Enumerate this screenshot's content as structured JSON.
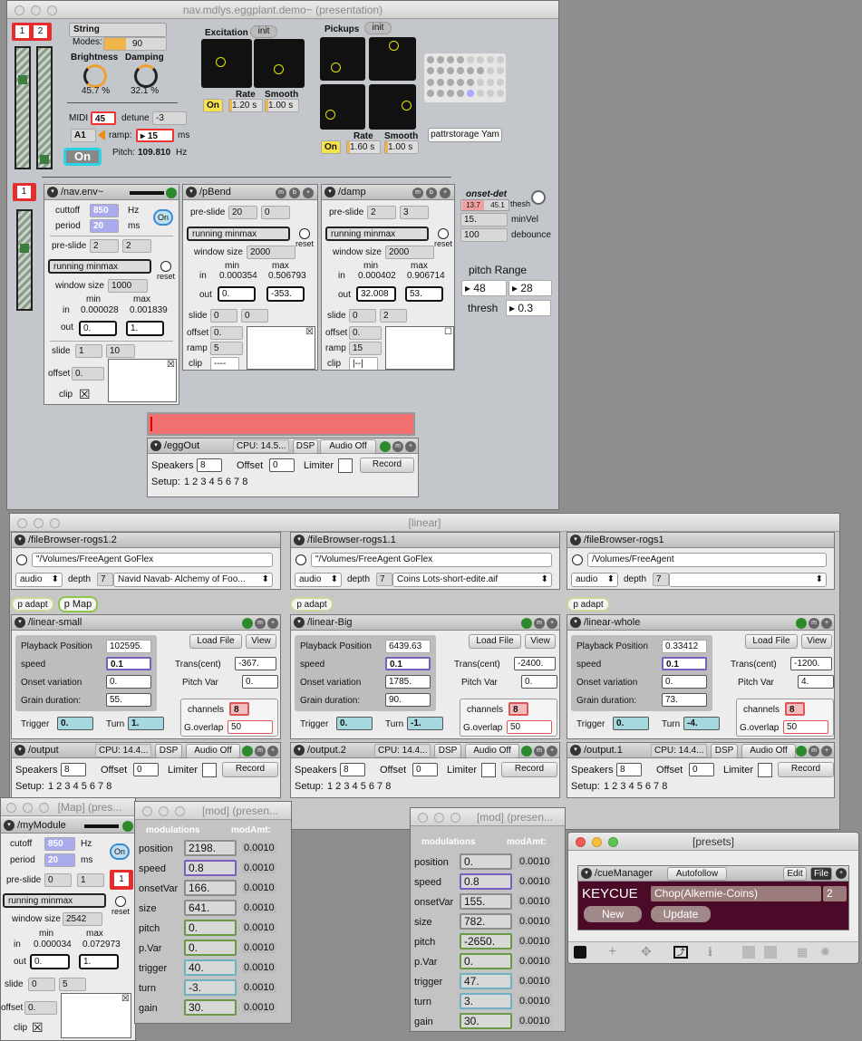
{
  "main_window": {
    "title": "nav.mdlys.eggplant.demo~ (presentation)",
    "badge1": "1",
    "badge2": "2",
    "instrument": "String",
    "modes_label": "Modes:",
    "modes_value": "90",
    "brightness_label": "Brightness",
    "brightness_value": "45.7 %",
    "damping_label": "Damping",
    "damping_value": "32.1 %",
    "midi_label": "MIDI",
    "midi_value": "45",
    "detune_label": "detune",
    "detune_value": "-3",
    "note": "A1",
    "ramp_label": "ramp:",
    "ramp_value": "15",
    "ramp_unit": "ms",
    "on_label": "On",
    "pitch_label": "Pitch:",
    "pitch_value": "109.810",
    "pitch_unit": "Hz",
    "excitation": {
      "label": "Excitation",
      "init": "init",
      "on": "On",
      "rate_label": "Rate",
      "rate_value": "1.20 s",
      "smooth_label": "Smooth",
      "smooth_value": "1.00 s"
    },
    "pickups": {
      "label": "Pickups",
      "init": "init",
      "on": "On",
      "rate_label": "Rate",
      "rate_value": "1.60 s",
      "smooth_label": "Smooth",
      "smooth_value": "1.00 s",
      "pattr": "pattrstorage Yam"
    },
    "env_badge": "1",
    "nav_env": {
      "title": "/nav.env~",
      "cutoff_label": "cuttoff",
      "cutoff_value": "850",
      "cutoff_unit": "Hz",
      "period_label": "period",
      "period_value": "20",
      "period_unit": "ms",
      "on": "On",
      "preslide_label": "pre-slide",
      "preslide_a": "2",
      "preslide_b": "2",
      "mode": "running minmax",
      "reset": "reset",
      "window_label": "window size",
      "window_value": "1000",
      "min_label": "min",
      "max_label": "max",
      "in_label": "in",
      "in_min": "0.000028",
      "in_max": "0.001839",
      "out_label": "out",
      "out_a": "0.",
      "out_b": "1.",
      "slide_label": "slide",
      "slide_a": "1",
      "slide_b": "10",
      "offset_label": "offset",
      "offset_value": "0.",
      "clip_label": "clip"
    },
    "pbend": {
      "title": "/pBend",
      "preslide_label": "pre-slide",
      "preslide_a": "20",
      "preslide_b": "0",
      "mode": "running minmax",
      "reset": "reset",
      "window_label": "window size",
      "window_value": "2000",
      "min_label": "min",
      "max_label": "max",
      "in_label": "in",
      "in_min": "0.000354",
      "in_max": "0.506793",
      "out_label": "out",
      "out_a": "0.",
      "out_b": "-353.",
      "slide_label": "slide",
      "slide_a": "0",
      "slide_b": "0",
      "offset_label": "offset",
      "offset_value": "0.",
      "ramp_label": "ramp",
      "ramp_value": "5",
      "clip_label": "clip",
      "clip_value": "----"
    },
    "damp": {
      "title": "/damp",
      "preslide_label": "pre-slide",
      "preslide_a": "2",
      "preslide_b": "3",
      "mode": "running minmax",
      "reset": "reset",
      "window_label": "window size",
      "window_value": "2000",
      "min_label": "min",
      "max_label": "max",
      "in_label": "in",
      "in_min": "0.000402",
      "in_max": "0.906714",
      "out_label": "out",
      "out_a": "32.008",
      "out_b": "53.",
      "slide_label": "slide",
      "slide_a": "0",
      "slide_b": "2",
      "offset_label": "offset",
      "offset_value": "0.",
      "ramp_label": "ramp",
      "ramp_value": "15",
      "clip_label": "clip",
      "clip_value": "|--|"
    },
    "onset": {
      "title": "onset-det",
      "a": "13.7",
      "b": "45.1",
      "thresh_label": "thesh",
      "minvel_value": "15.",
      "minvel_label": "minVel",
      "debounce_value": "100",
      "debounce_label": "debounce",
      "pitchrange_label": "pitch Range",
      "pr_a": "48",
      "pr_b": "28",
      "thresh2_label": "thresh",
      "thresh2_value": "0.3"
    },
    "eggout": {
      "title": "/eggOut",
      "cpu": "CPU: 14.5...",
      "dsp": "DSP",
      "audio": "Audio Off",
      "speakers_label": "Speakers",
      "speakers_value": "8",
      "offset_label": "Offset",
      "offset_value": "0",
      "limiter_label": "Limiter",
      "record": "Record",
      "setup_label": "Setup:",
      "setup_values": "1 2 3 4 5 6 7 8"
    }
  },
  "linear_window": {
    "title": "[linear]",
    "browsers": [
      {
        "title": "/fileBrowser-rogs1.2",
        "path": "\"/Volumes/FreeAgent GoFlex",
        "type": "audio",
        "depth_label": "depth",
        "depth": "7",
        "file": "Navid Navab- Alchemy of Foo...",
        "adapt": "p adapt",
        "map": "p Map"
      },
      {
        "title": "/fileBrowser-rogs1.1",
        "path": "\"/Volumes/FreeAgent GoFlex",
        "type": "audio",
        "depth_label": "depth",
        "depth": "7",
        "file": "Coins Lots-short-edite.aif",
        "adapt": "p adapt"
      },
      {
        "title": "/fileBrowser-rogs1",
        "path": "/Volumes/FreeAgent",
        "type": "audio",
        "depth_label": "depth",
        "depth": "7",
        "file": "",
        "adapt": "p adapt"
      }
    ],
    "players": [
      {
        "title": "/linear-small",
        "load": "Load File",
        "view": "View",
        "pb_label": "Playback Position",
        "pb": "102595.",
        "speed_label": "speed",
        "speed": "0.1",
        "trans_label": "Trans(cent)",
        "trans": "-367.",
        "onset_label": "Onset variation",
        "onset": "0.",
        "pitchvar_label": "Pitch Var",
        "pitchvar": "0.",
        "grain_label": "Grain duration:",
        "grain": "55.",
        "channels_label": "channels",
        "channels": "8",
        "goverlap_label": "G.overlap",
        "goverlap": "50",
        "trigger_label": "Trigger",
        "trigger": "0.",
        "turn_label": "Turn",
        "turn": "1."
      },
      {
        "title": "/linear-Big",
        "load": "Load File",
        "view": "View",
        "pb_label": "Playback Position",
        "pb": "6439.63",
        "speed_label": "speed",
        "speed": "0.1",
        "trans_label": "Trans(cent)",
        "trans": "-2400.",
        "onset_label": "Onset variation",
        "onset": "1785.",
        "pitchvar_label": "Pitch Var",
        "pitchvar": "0.",
        "grain_label": "Grain duration:",
        "grain": "90.",
        "channels_label": "channels",
        "channels": "8",
        "goverlap_label": "G.overlap",
        "goverlap": "50",
        "trigger_label": "Trigger",
        "trigger": "0.",
        "turn_label": "Turn",
        "turn": "-1."
      },
      {
        "title": "/linear-whole",
        "load": "Load File",
        "view": "View",
        "pb_label": "Playback Position",
        "pb": "0.33412",
        "speed_label": "speed",
        "speed": "0.1",
        "trans_label": "Trans(cent)",
        "trans": "-1200.",
        "onset_label": "Onset variation",
        "onset": "0.",
        "pitchvar_label": "Pitch Var",
        "pitchvar": "4.",
        "grain_label": "Grain duration:",
        "grain": "73.",
        "channels_label": "channels",
        "channels": "8",
        "goverlap_label": "G.overlap",
        "goverlap": "50",
        "trigger_label": "Trigger",
        "trigger": "0.",
        "turn_label": "Turn",
        "turn": "-4."
      }
    ],
    "outputs": [
      {
        "title": "/output",
        "cpu": "CPU: 14.4...",
        "dsp": "DSP",
        "audio": "Audio Off",
        "speakers_label": "Speakers",
        "speakers_value": "8",
        "offset_label": "Offset",
        "offset_value": "0",
        "limiter_label": "Limiter",
        "record": "Record",
        "setup_label": "Setup:",
        "setup_values": "1 2 3 4 5 6 7 8"
      },
      {
        "title": "/output.2",
        "cpu": "CPU: 14.4...",
        "dsp": "DSP",
        "audio": "Audio Off",
        "speakers_label": "Speakers",
        "speakers_value": "8",
        "offset_label": "Offset",
        "offset_value": "0",
        "limiter_label": "Limiter",
        "record": "Record",
        "setup_label": "Setup:",
        "setup_values": "1 2 3 4 5 6 7 8"
      },
      {
        "title": "/output.1",
        "cpu": "CPU: 14.4...",
        "dsp": "DSP",
        "audio": "Audio Off",
        "speakers_label": "Speakers",
        "speakers_value": "8",
        "offset_label": "Offset",
        "offset_value": "0",
        "limiter_label": "Limiter",
        "record": "Record",
        "setup_label": "Setup:",
        "setup_values": "1 2 3 4 5 6 7 8"
      }
    ]
  },
  "map_window": {
    "title": "[Map] (pres...",
    "module": "/myModule",
    "cutoff_label": "cutoff",
    "cutoff_value": "850",
    "cutoff_unit": "Hz",
    "period_label": "period",
    "period_value": "20",
    "period_unit": "ms",
    "on": "On",
    "preslide_label": "pre-slide",
    "preslide_a": "0",
    "preslide_b": "1",
    "badge": "1",
    "mode": "running minmax",
    "reset": "reset",
    "window_label": "window size",
    "window_value": "2542",
    "min_label": "min",
    "max_label": "max",
    "in_label": "in",
    "in_min": "0.000034",
    "in_max": "0.072973",
    "out_label": "out",
    "out_a": "0.",
    "out_b": "1.",
    "slide_label": "slide",
    "slide_a": "0",
    "slide_b": "5",
    "offset_label": "offset",
    "offset_value": "0.",
    "clip_label": "clip"
  },
  "mod_windows": [
    {
      "title": "[mod] (presen...",
      "col1": "modulations",
      "col2": "modAmt:",
      "rows": [
        {
          "name": "position",
          "value": "2198.",
          "amt": "0.0010"
        },
        {
          "name": "speed",
          "value": "0.8",
          "amt": "0.0010"
        },
        {
          "name": "onsetVar",
          "value": "166.",
          "amt": "0.0010"
        },
        {
          "name": "size",
          "value": "641.",
          "amt": "0.0010"
        },
        {
          "name": "pitch",
          "value": "0.",
          "amt": "0.0010"
        },
        {
          "name": "p.Var",
          "value": "0.",
          "amt": "0.0010"
        },
        {
          "name": "trigger",
          "value": "40.",
          "amt": "0.0010"
        },
        {
          "name": "turn",
          "value": "-3.",
          "amt": "0.0010"
        },
        {
          "name": "gain",
          "value": "30.",
          "amt": "0.0010"
        }
      ]
    },
    {
      "title": "[mod] (presen...",
      "col1": "modulations",
      "col2": "modAmt:",
      "rows": [
        {
          "name": "position",
          "value": "0.",
          "amt": "0.0010"
        },
        {
          "name": "speed",
          "value": "0.8",
          "amt": "0.0010"
        },
        {
          "name": "onsetVar",
          "value": "155.",
          "amt": "0.0010"
        },
        {
          "name": "size",
          "value": "782.",
          "amt": "0.0010"
        },
        {
          "name": "pitch",
          "value": "-2650.",
          "amt": "0.0010"
        },
        {
          "name": "p.Var",
          "value": "0.",
          "amt": "0.0010"
        },
        {
          "name": "trigger",
          "value": "47.",
          "amt": "0.0010"
        },
        {
          "name": "turn",
          "value": "3.",
          "amt": "0.0010"
        },
        {
          "name": "gain",
          "value": "30.",
          "amt": "0.0010"
        }
      ]
    }
  ],
  "presets_window": {
    "title": "[presets]",
    "cue_title": "/cueManager",
    "autofollow": "Autofollow",
    "edit": "Edit",
    "file": "File",
    "keycue": "KEYCUE",
    "cue_name": "Chop(Alkemie-Coins)",
    "cue_num": "2",
    "new": "New",
    "update": "Update"
  }
}
